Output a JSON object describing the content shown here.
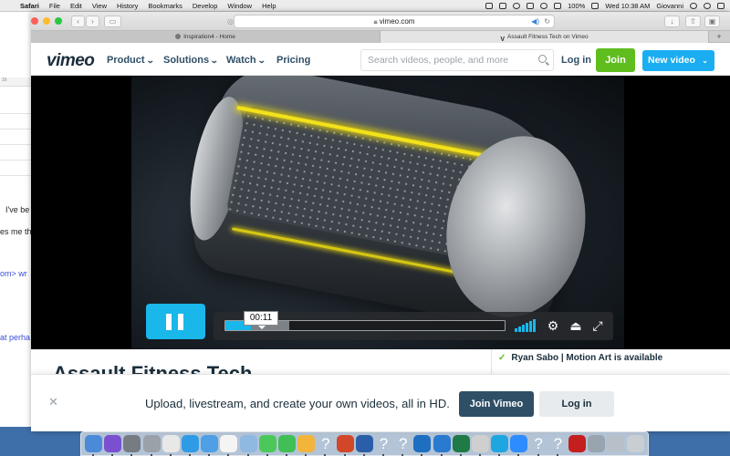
{
  "menubar": {
    "items": [
      "Safari",
      "File",
      "Edit",
      "View",
      "History",
      "Bookmarks",
      "Develop",
      "Window",
      "Help"
    ],
    "battery": "100%",
    "clock": "Wed 10:38 AM",
    "user": "Giovanni"
  },
  "background_doc": {
    "ruler": "16",
    "line1": "I've be",
    "line2": "es me th",
    "line3": "om> wr",
    "line4": "at perha"
  },
  "browser": {
    "url": "vimeo.com",
    "tabs": [
      {
        "label": "Inspiration4 - Home",
        "active": false
      },
      {
        "label": "Assault Fitness Tech on Vimeo",
        "active": true
      }
    ],
    "new_tab": "+"
  },
  "vimeo": {
    "logo": "vimeo",
    "nav": {
      "product": "Product",
      "solutions": "Solutions",
      "watch": "Watch",
      "pricing": "Pricing"
    },
    "search_placeholder": "Search videos, people, and more",
    "login": "Log in",
    "join": "Join",
    "new_video": "New video",
    "player": {
      "current_time": "00:11",
      "progress_played": 0.09,
      "progress_buffered": 0.23,
      "volume_level": 1.0
    },
    "video_title": "Assault Fitness Tech",
    "availability": "Ryan Sabo | Motion Art is available",
    "banner": {
      "message": "Upload, livestream, and create your own videos, all in HD.",
      "join": "Join Vimeo",
      "login": "Log in"
    }
  },
  "colors": {
    "accent_blue": "#19b7ea",
    "join_green": "#5fbd1e",
    "navy": "#1a2e3b"
  },
  "dock": {
    "icons": [
      "finder-icon",
      "siri-icon",
      "system-preferences-icon",
      "launchpad-icon",
      "chrome-icon",
      "safari-icon",
      "mail-icon",
      "calendar-icon",
      "preview-icon",
      "messages-icon",
      "facetime-icon",
      "photos-icon",
      "unknown-app-icon",
      "powerpoint-icon",
      "word-icon",
      "unknown-app-icon",
      "unknown-app-icon",
      "outlook-icon",
      "onedrive-icon",
      "excel-icon",
      "script-editor-icon",
      "skype-icon",
      "zoom-icon",
      "unknown-app-icon",
      "unknown-app-icon",
      "acrobat-icon",
      "image-capture-icon",
      "downloads-stack-icon",
      "trash-icon"
    ]
  }
}
